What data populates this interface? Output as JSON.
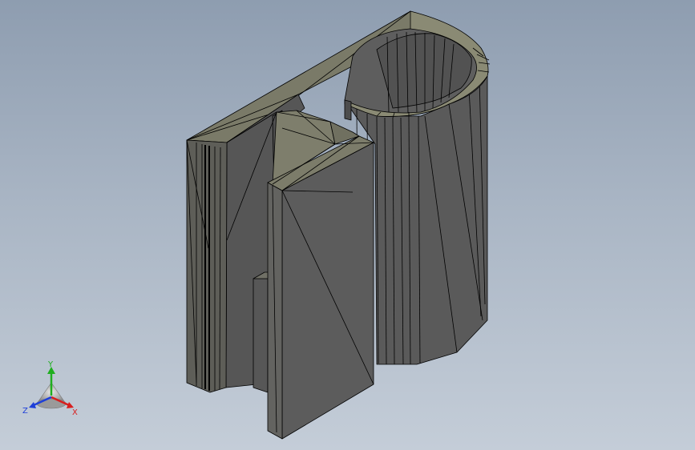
{
  "viewport": {
    "background_top": "#8e9db0",
    "background_bottom": "#c4cdd8"
  },
  "model": {
    "face_color": "#5c5c5c",
    "face_dark": "#4a4a4a",
    "face_light": "#6f6f68",
    "top_face_color": "#7a7a68",
    "edge_color": "#000000"
  },
  "triad": {
    "x_label": "X",
    "y_label": "Y",
    "z_label": "Z",
    "x_color": "#d81e1e",
    "y_color": "#1fae1f",
    "z_color": "#1e3fd8",
    "center_color": "#b0b0b0"
  }
}
